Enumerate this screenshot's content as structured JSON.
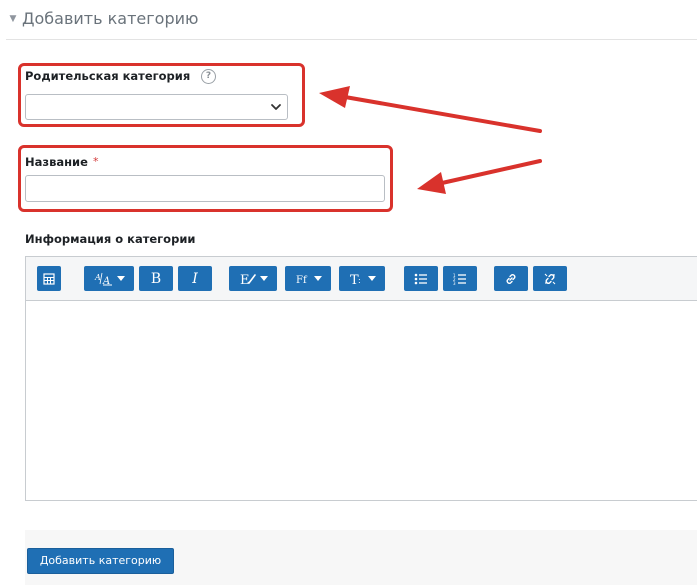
{
  "section": {
    "title": "Добавить категорию",
    "collapse_icon": "triangle-down"
  },
  "fields": {
    "parent": {
      "label": "Родительская категория",
      "help_icon": "question-circle",
      "value": ""
    },
    "name": {
      "label": "Название",
      "required_marker": "*",
      "value": ""
    },
    "description": {
      "label": "Информация о категории"
    }
  },
  "editor": {
    "toolbar": [
      {
        "name": "toolbar-toggle-icon",
        "glyph": "grid"
      },
      {
        "name": "font-size-icon",
        "glyph": "A/A"
      },
      {
        "name": "bold-icon",
        "glyph": "B"
      },
      {
        "name": "italic-icon",
        "glyph": "I"
      },
      {
        "name": "style-icon",
        "glyph": "E✓"
      },
      {
        "name": "font-family-icon",
        "glyph": "Ff"
      },
      {
        "name": "text-format-icon",
        "glyph": "T"
      },
      {
        "name": "bullet-list-icon",
        "glyph": "ul"
      },
      {
        "name": "numbered-list-icon",
        "glyph": "ol"
      },
      {
        "name": "link-icon",
        "glyph": "link"
      },
      {
        "name": "unlink-icon",
        "glyph": "unlink"
      }
    ]
  },
  "submit": {
    "label": "Добавить категорию"
  },
  "annotations": {
    "highlight_color": "#d9322c"
  },
  "colors": {
    "primary": "#1f6fb4",
    "required": "#d33a3a"
  }
}
